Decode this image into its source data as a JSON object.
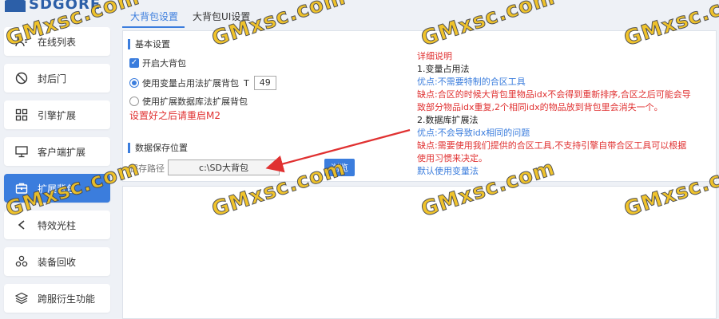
{
  "app": {
    "logo_text": "SDGORE"
  },
  "sidebar": {
    "items": [
      {
        "label": "在线列表",
        "icon": "user-list-icon",
        "active": false
      },
      {
        "label": "封后门",
        "icon": "ban-icon",
        "active": false
      },
      {
        "label": "引擎扩展",
        "icon": "grid-icon",
        "active": false
      },
      {
        "label": "客户端扩展",
        "icon": "monitor-icon",
        "active": false
      },
      {
        "label": "扩展背包",
        "icon": "backpack-icon",
        "active": true
      },
      {
        "label": "特效光柱",
        "icon": "chevron-icon",
        "active": false
      },
      {
        "label": "装备回收",
        "icon": "recycle-icon",
        "active": false
      },
      {
        "label": "跨服衍生功能",
        "icon": "layers-icon",
        "active": false
      }
    ]
  },
  "tabs": [
    {
      "label": "大背包设置",
      "active": true
    },
    {
      "label": "大背包UI设置",
      "active": false
    }
  ],
  "basic": {
    "title": "基本设置",
    "enable_label": "开启大背包",
    "enable_checked": true,
    "radio_var_label": "使用变量占用法扩展背包",
    "radio_var_checked": true,
    "spin_prefix": "T",
    "spin_value": "49",
    "radio_db_label": "使用扩展数据库法扩展背包",
    "radio_db_checked": false,
    "restart_note": "设置好之后请重启M2"
  },
  "storage": {
    "title": "数据保存位置",
    "path_label": "保存路径",
    "path_value": "c:\\SD大背包",
    "browse_label": "浏览"
  },
  "details": {
    "title": "详细说明",
    "lines": [
      {
        "text": "1.变量占用法",
        "style": "d"
      },
      {
        "text": "优点:不需要特制的合区工具",
        "style": "b"
      },
      {
        "text": "缺点:合区的时候大背包里物品idx不会得到重新排序,合区之后可能会导",
        "style": "h"
      },
      {
        "text": "致部分物品idx重复,2个相同idx的物品放到背包里会消失一个。",
        "style": "h"
      },
      {
        "text": "2.数据库扩展法",
        "style": "d"
      },
      {
        "text": "优点:不会导致idx相同的问题",
        "style": "b"
      },
      {
        "text": "缺点:需要使用我们提供的合区工具,不支持引擎自带合区工具可以根据",
        "style": "h"
      },
      {
        "text": "使用习惯来决定。",
        "style": "h"
      },
      {
        "text": "默认使用变量法",
        "style": "b"
      }
    ]
  },
  "watermark": {
    "text": "GMxsc.com",
    "color": "#f0c020"
  },
  "colors": {
    "accent": "#3b7ddd",
    "warning": "#e03131"
  }
}
